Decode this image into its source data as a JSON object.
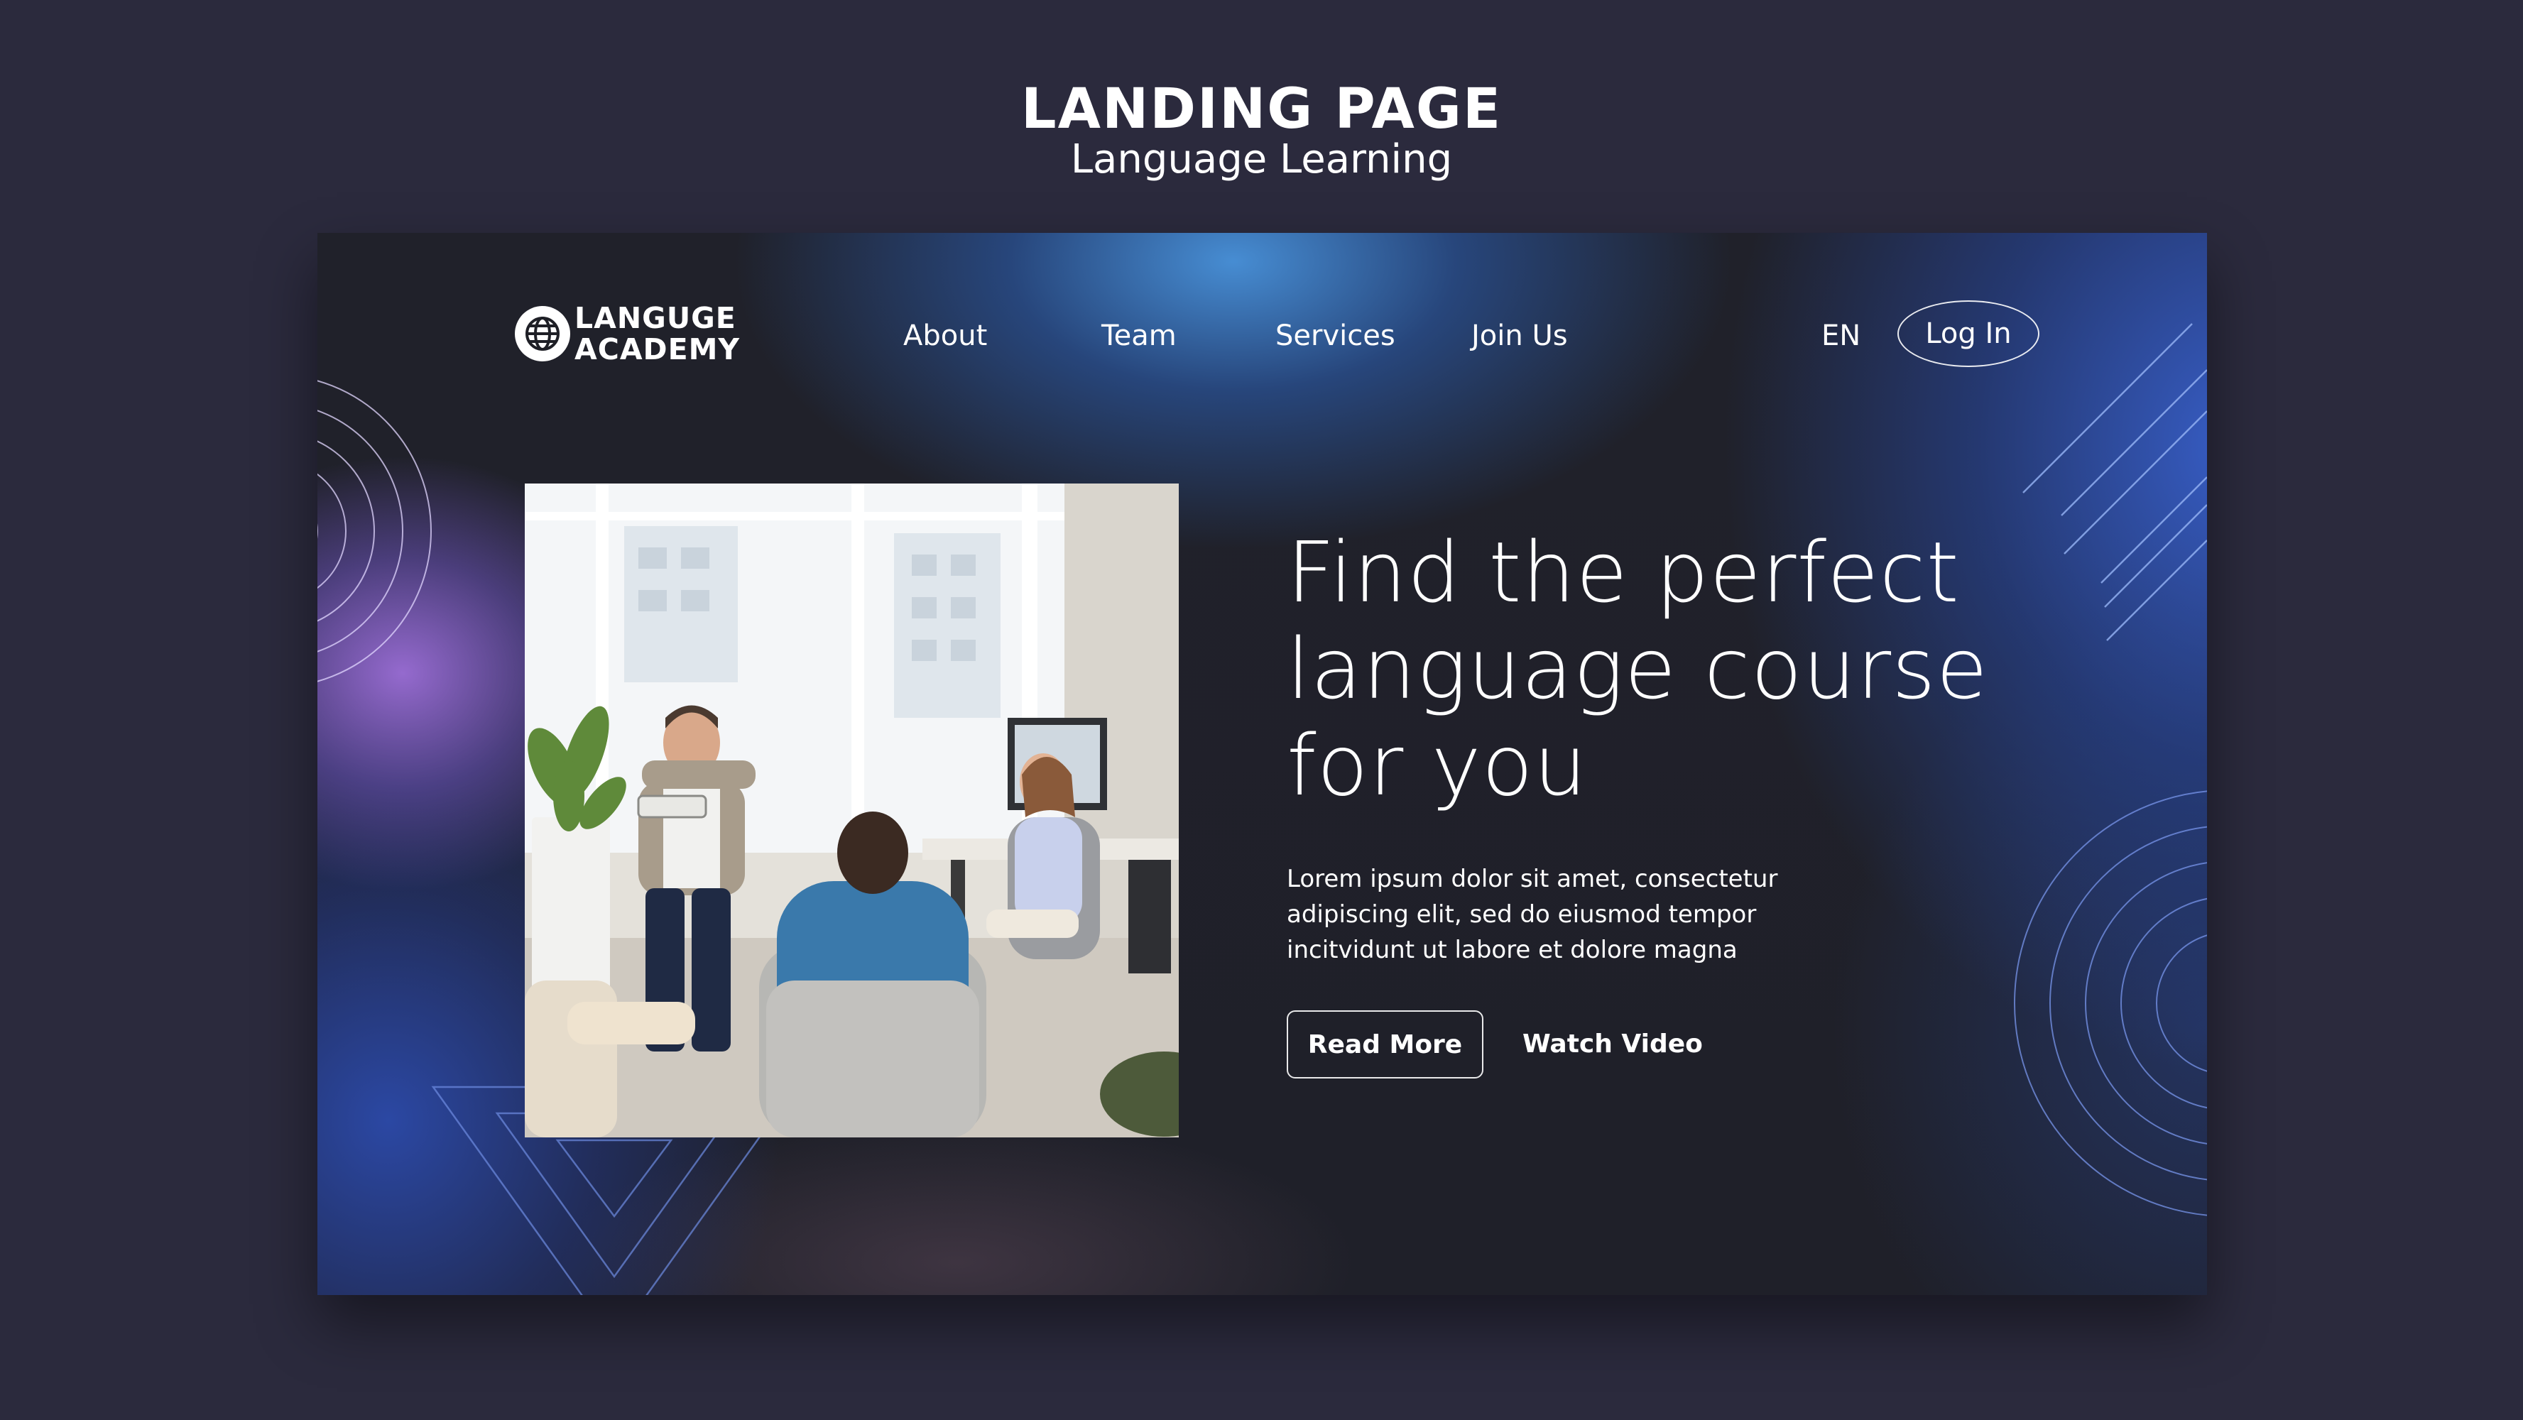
{
  "showcase": {
    "title": "LANDING PAGE",
    "subtitle": "Language Learning"
  },
  "brand": {
    "line1": "LANGUGE",
    "line2": "ACADEMY",
    "icon": "globe-icon"
  },
  "nav": {
    "items": [
      {
        "label": "About"
      },
      {
        "label": "Team"
      },
      {
        "label": "Services"
      },
      {
        "label": "Join Us"
      }
    ],
    "language": "EN",
    "login_label": "Log In"
  },
  "hero": {
    "headline_lines": [
      "Find the perfect",
      "language course",
      "for you"
    ],
    "body_lines": [
      "Lorem ipsum dolor sit amet, consectetur",
      "adipiscing elit, sed do eiusmod tempor",
      "incitvidunt ut labore et dolore magna"
    ],
    "primary_button": "Read More",
    "secondary_button": "Watch Video"
  },
  "colors": {
    "page_background": "#2b2a3d",
    "site_background": "#1e1f26",
    "accent_blue": "#3a62cf",
    "accent_purple": "#9b6ed7",
    "text": "#ffffff"
  }
}
